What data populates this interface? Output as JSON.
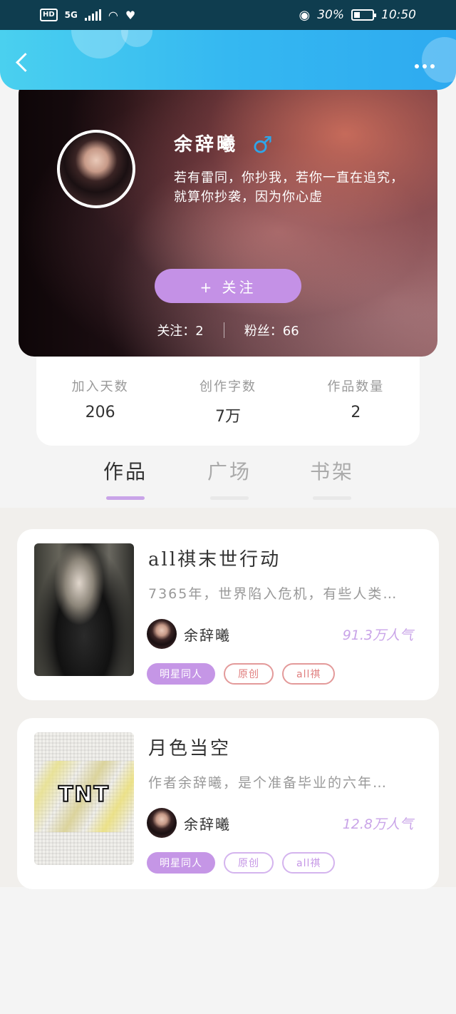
{
  "status_bar": {
    "left": [
      "HD",
      "5G"
    ],
    "battery": "30%",
    "time": "10:50",
    "icons": [
      "hd-icon",
      "signal-icon",
      "wifi-icon",
      "heart-pulse-icon",
      "eye-icon",
      "battery-icon"
    ]
  },
  "nav": {
    "back_icon": "chevron-left-icon",
    "more_icon": "more-dots-icon",
    "accent": "#35b8f1"
  },
  "profile": {
    "name": "余辞曦",
    "gender_symbol": "♂",
    "bio": "若有雷同，你抄我，若你一直在追究，就算你抄袭，因为你心虚",
    "follow_button": "+ 关注",
    "following_label": "关注：2",
    "followers_label": "粉丝：66"
  },
  "stats": [
    {
      "label": "加入天数",
      "value": "206"
    },
    {
      "label": "创作字数",
      "value": "7万"
    },
    {
      "label": "作品数量",
      "value": "2"
    }
  ],
  "tabs": [
    {
      "label": "作品",
      "active": true
    },
    {
      "label": "广场",
      "active": false
    },
    {
      "label": "书架",
      "active": false
    }
  ],
  "works": [
    {
      "title": "all祺末世行动",
      "description": "7365年，世界陷入危机，有些人类…",
      "author": "余辞曦",
      "popularity": "91.3万人气",
      "tags": [
        "明星同人",
        "原创",
        "all祺"
      ]
    },
    {
      "title": "月色当空",
      "description": "作者余辞曦，是个准备毕业的六年…",
      "author": "余辞曦",
      "popularity": "12.8万人气",
      "cover_text": "TNT",
      "tags": [
        "明星同人",
        "原创",
        "all祺"
      ]
    }
  ],
  "colors": {
    "tab_accent": "#c9a4e8",
    "follow_button": "#c491e6",
    "tag_red": "#e07e7e"
  }
}
